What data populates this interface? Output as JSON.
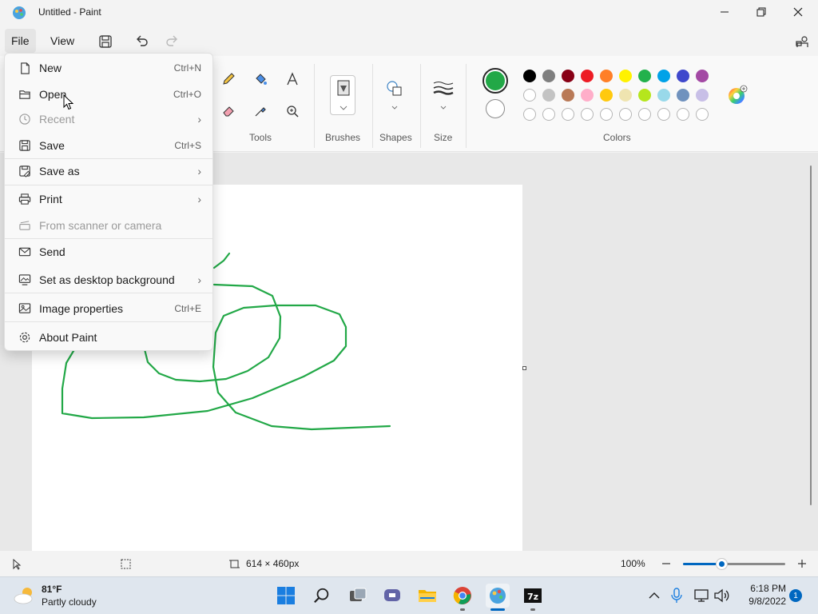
{
  "window": {
    "title": "Untitled - Paint"
  },
  "menubar": {
    "file": "File",
    "view": "View"
  },
  "ribbon": {
    "tools_label": "Tools",
    "brushes_label": "Brushes",
    "shapes_label": "Shapes",
    "size_label": "Size",
    "colors_label": "Colors",
    "primary_color": "#22a847",
    "secondary_color": "#ffffff",
    "palette_row1": [
      "#000000",
      "#7f7f7f",
      "#880015",
      "#ed1c24",
      "#ff7f27",
      "#fff200",
      "#22b14c",
      "#00a2e8",
      "#3f48cc",
      "#a349a4"
    ],
    "palette_row2": [
      "#ffffff",
      "#c3c3c3",
      "#b97a57",
      "#ffaec9",
      "#ffc90e",
      "#efe4b0",
      "#b5e61d",
      "#99d9ea",
      "#7092be",
      "#c8bfe7"
    ]
  },
  "file_menu": {
    "items": [
      {
        "label": "New",
        "shortcut": "Ctrl+N",
        "icon": "new-file-icon"
      },
      {
        "label": "Open",
        "shortcut": "Ctrl+O",
        "icon": "folder-icon"
      },
      {
        "label": "Recent",
        "arrow": "›",
        "icon": "clock-icon",
        "disabled": true
      },
      {
        "label": "Save",
        "shortcut": "Ctrl+S",
        "icon": "save-icon"
      },
      {
        "label": "Save as",
        "arrow": "›",
        "icon": "save-as-icon"
      },
      {
        "label": "Print",
        "arrow": "›",
        "icon": "print-icon"
      },
      {
        "label": "From scanner or camera",
        "icon": "scanner-icon",
        "disabled": true
      },
      {
        "label": "Send",
        "icon": "send-icon"
      },
      {
        "label": "Set as desktop background",
        "arrow": "›",
        "icon": "desktop-background-icon"
      },
      {
        "label": "Image properties",
        "shortcut": "Ctrl+E",
        "icon": "image-properties-icon"
      },
      {
        "label": "About Paint",
        "icon": "gear-icon"
      }
    ]
  },
  "statusbar": {
    "dimensions": "614 × 460px",
    "zoom": "100%"
  },
  "taskbar": {
    "weather_temp": "81°F",
    "weather_desc": "Partly cloudy",
    "time": "6:18 PM",
    "date": "9/8/2022",
    "notification_count": "1"
  }
}
